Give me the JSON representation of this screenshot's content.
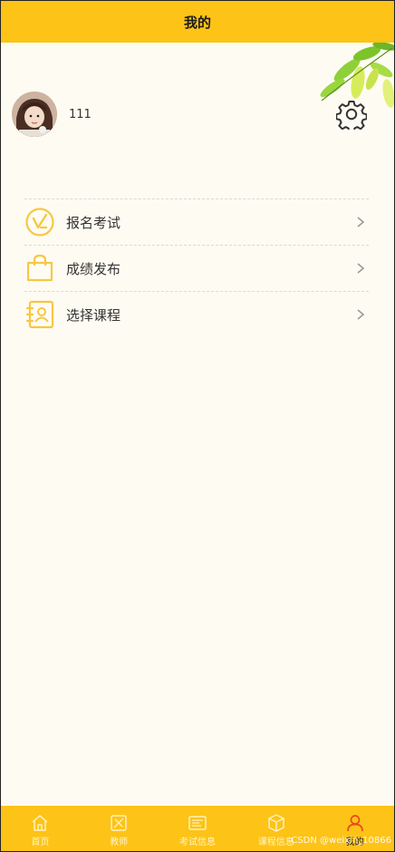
{
  "header": {
    "title": "我的"
  },
  "profile": {
    "username": "111"
  },
  "menu": {
    "items": [
      {
        "label": "报名考试",
        "icon": "signup-check-icon"
      },
      {
        "label": "成绩发布",
        "icon": "shopping-bag-icon"
      },
      {
        "label": "选择课程",
        "icon": "contact-book-icon"
      }
    ]
  },
  "tabbar": {
    "tabs": [
      {
        "label": "首页",
        "icon": "home-icon"
      },
      {
        "label": "教师",
        "icon": "teacher-icon"
      },
      {
        "label": "考试信息",
        "icon": "exam-info-icon"
      },
      {
        "label": "课程信息",
        "icon": "course-box-icon"
      },
      {
        "label": "我的",
        "icon": "person-icon",
        "active": true
      }
    ]
  },
  "watermark": "CSDN @weixin_10866",
  "colors": {
    "brand_yellow": "#fdc317",
    "page_bg": "#fefcf2",
    "icon_yellow": "#f7c744",
    "active_tab": "#e8491d"
  }
}
